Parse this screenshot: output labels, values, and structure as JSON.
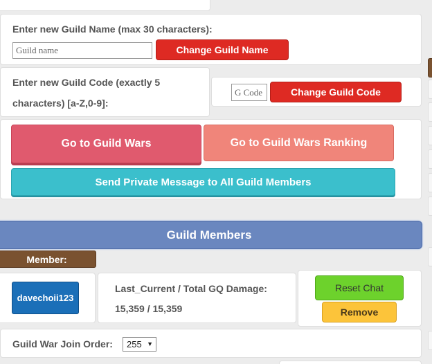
{
  "guild_name": {
    "label": "Enter new Guild Name (max 30 characters):",
    "placeholder": "Guild name",
    "button": "Change Guild Name"
  },
  "guild_code": {
    "label_line1": "Enter new Guild Code (exactly 5",
    "label_line2": "characters) [a-Z,0-9]:",
    "placeholder": "G Code",
    "button": "Change Guild Code"
  },
  "actions": {
    "guild_wars": "Go to Guild Wars",
    "guild_wars_ranking": "Go to Guild Wars Ranking",
    "private_message": "Send Private Message to All Guild Members"
  },
  "members_section": {
    "title": "Guild Members",
    "member_header": "Member:"
  },
  "member": {
    "name": "davechoii123",
    "damage_label": "Last_Current / Total GQ Damage:",
    "damage_value": "15,359 / 15,359",
    "reset_chat": "Reset Chat",
    "remove": "Remove"
  },
  "join_order": {
    "label": "Guild War Join Order:",
    "value": "255"
  },
  "colors": {
    "red_button": "#de2a23",
    "pink_button": "#e05a6e",
    "salmon_button": "#f0857a",
    "teal_button": "#3bbfcc",
    "section_header": "#6a87bf",
    "member_tag": "#7a5230",
    "member_name_button": "#1b6fb8",
    "green_button": "#6dd22c",
    "yellow_button": "#fcc43a"
  }
}
